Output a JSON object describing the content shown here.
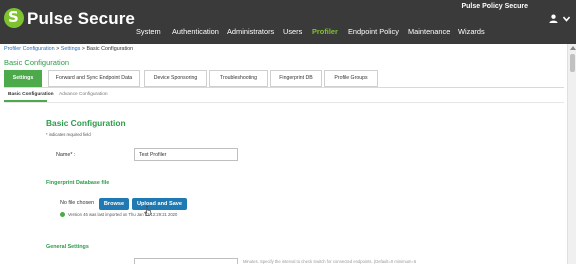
{
  "header": {
    "logo_text": "Pulse Secure",
    "product_name": "Pulse Policy Secure",
    "user_icon": "user-icon",
    "nav": [
      {
        "label": "System",
        "active": false
      },
      {
        "label": "Authentication",
        "active": false
      },
      {
        "label": "Administrators",
        "active": false
      },
      {
        "label": "Users",
        "active": false
      },
      {
        "label": "Profiler",
        "active": true
      },
      {
        "label": "Endpoint Policy",
        "active": false
      },
      {
        "label": "Maintenance",
        "active": false
      },
      {
        "label": "Wizards",
        "active": false
      }
    ],
    "accent_color": "#7ec22f"
  },
  "breadcrumb": {
    "items": [
      "Profiler Configuration",
      "Settings",
      "Basic Configuration"
    ],
    "separator": ">"
  },
  "page_heading": "Basic Configuration",
  "tabs": [
    {
      "label": "Settings",
      "active": true
    },
    {
      "label": "Forward and Sync Endpoint Data",
      "active": false
    },
    {
      "label": "Device Sponsoring",
      "active": false
    },
    {
      "label": "Troubleshooting",
      "active": false
    },
    {
      "label": "Fingerprint DB",
      "active": false
    },
    {
      "label": "Profile Groups",
      "active": false
    }
  ],
  "subtabs": [
    {
      "label": "Basic Configuration",
      "active": true
    },
    {
      "label": "Advance Configuration",
      "active": false
    }
  ],
  "content": {
    "section_title": "Basic Configuration",
    "required_note": "* indicates required field",
    "name_label": "Name* :",
    "name_value": "Test Profiler",
    "fingerprint_title": "Fingerprint Database file",
    "no_file_text": "No file chosen",
    "browse_label": "Browse",
    "upload_label": "Upload and Save",
    "status_text": "Version 46 was last imported on Thu Jan 23 12:29:21 2020",
    "status_icon": "check-circle-icon",
    "general_title": "General Settings",
    "general_help_text": "Minutes. Specify the interval to check Switch for connected endpoints. (Default=0 minimum=5",
    "brand_color": "#2e9c4a",
    "button_color": "#1f7ab3"
  }
}
